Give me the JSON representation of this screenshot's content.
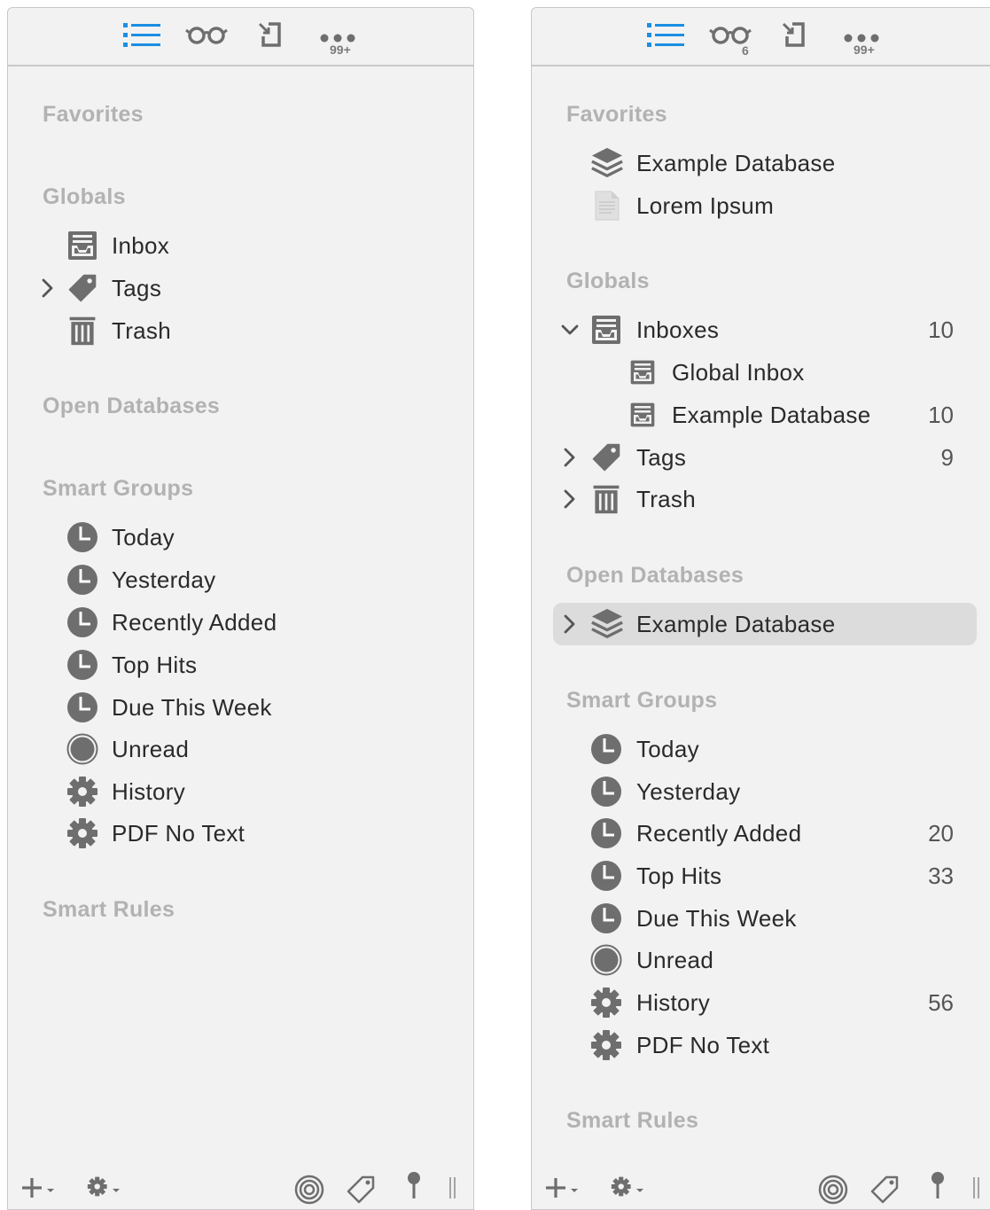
{
  "left": {
    "toolbar": {
      "more_badge": "99+"
    },
    "sections": {
      "favorites": "Favorites",
      "globals": "Globals",
      "open_databases": "Open Databases",
      "smart_groups": "Smart Groups",
      "smart_rules": "Smart Rules"
    },
    "globals": [
      {
        "label": "Inbox",
        "icon": "inbox-icon"
      },
      {
        "label": "Tags",
        "icon": "tag-icon"
      },
      {
        "label": "Trash",
        "icon": "trash-icon"
      }
    ],
    "smart_groups": [
      {
        "label": "Today",
        "icon": "clock-icon"
      },
      {
        "label": "Yesterday",
        "icon": "clock-icon"
      },
      {
        "label": "Recently Added",
        "icon": "clock-icon"
      },
      {
        "label": "Top Hits",
        "icon": "clock-icon"
      },
      {
        "label": "Due This Week",
        "icon": "clock-icon"
      },
      {
        "label": "Unread",
        "icon": "unread-circle-icon"
      },
      {
        "label": "History",
        "icon": "gear-icon"
      },
      {
        "label": "PDF No Text",
        "icon": "gear-icon"
      }
    ]
  },
  "right": {
    "toolbar": {
      "reading_badge": "6",
      "more_badge": "99+"
    },
    "sections": {
      "favorites": "Favorites",
      "globals": "Globals",
      "open_databases": "Open Databases",
      "smart_groups": "Smart Groups",
      "smart_rules": "Smart Rules"
    },
    "favorites": [
      {
        "label": "Example Database",
        "icon": "database-stack-icon"
      },
      {
        "label": "Lorem Ipsum",
        "icon": "document-icon"
      }
    ],
    "globals": [
      {
        "label": "Inboxes",
        "count": "10",
        "icon": "inbox-icon"
      },
      {
        "label": "Global Inbox",
        "count": "",
        "icon": "inbox-icon"
      },
      {
        "label": "Example Database",
        "count": "10",
        "icon": "inbox-icon"
      },
      {
        "label": "Tags",
        "count": "9",
        "icon": "tag-icon"
      },
      {
        "label": "Trash",
        "count": "",
        "icon": "trash-icon"
      }
    ],
    "open_databases": [
      {
        "label": "Example Database",
        "icon": "database-stack-icon"
      }
    ],
    "smart_groups": [
      {
        "label": "Today",
        "count": "",
        "icon": "clock-icon"
      },
      {
        "label": "Yesterday",
        "count": "",
        "icon": "clock-icon"
      },
      {
        "label": "Recently Added",
        "count": "20",
        "icon": "clock-icon"
      },
      {
        "label": "Top Hits",
        "count": "33",
        "icon": "clock-icon"
      },
      {
        "label": "Due This Week",
        "count": "",
        "icon": "clock-icon"
      },
      {
        "label": "Unread",
        "count": "",
        "icon": "unread-circle-icon"
      },
      {
        "label": "History",
        "count": "56",
        "icon": "gear-icon"
      },
      {
        "label": "PDF No Text",
        "count": "",
        "icon": "gear-icon"
      }
    ]
  },
  "colors": {
    "accent": "#1a8fe3",
    "panel_bg": "#f2f2f2",
    "icon_gray": "#6e6e6e",
    "section_gray": "#b2b2b2",
    "selection": "#dcdcdc"
  }
}
